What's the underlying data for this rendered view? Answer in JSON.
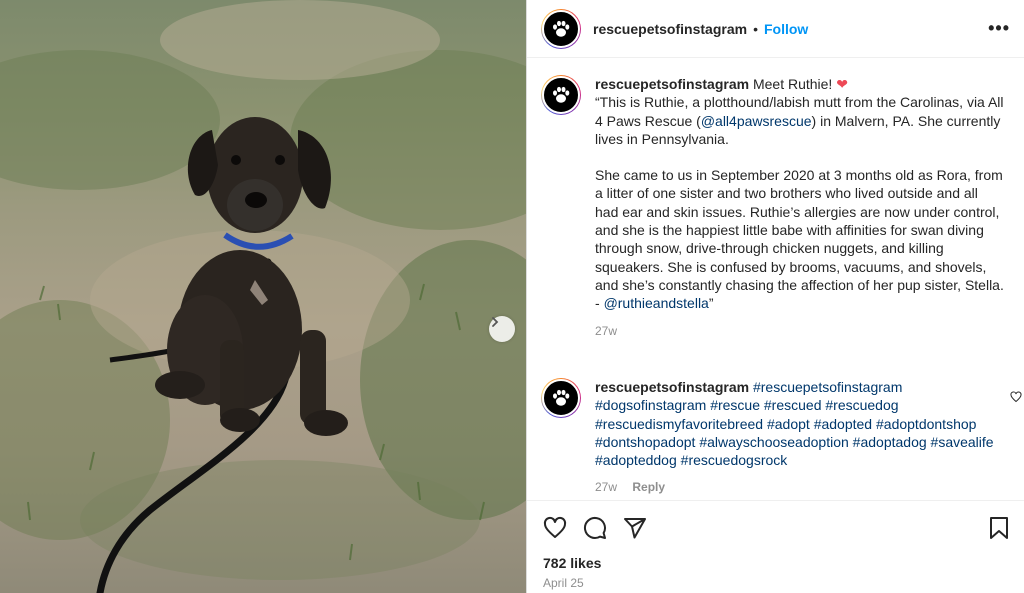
{
  "post": {
    "username": "rescuepetsofinstagram",
    "follow_label": "Follow",
    "more_label": "•••",
    "separator": "•"
  },
  "caption": {
    "username": "rescuepetsofinstagram",
    "title": "Meet Ruthie!",
    "p1_a": "“This is Ruthie, a plotthound/labish mutt from the Carolinas, via All 4 Paws Rescue (",
    "p1_link": "@all4pawsrescue",
    "p1_b": ") in Malvern, PA. She currently lives in Pennsylvania.",
    "p2": "She came to us in September 2020 at 3 months old as Rora, from a litter of one sister and two brothers who lived outside and all had ear and skin issues. Ruthie’s allergies are now under control, and she is the happiest little babe with affinities for swan diving through snow, drive-through chicken nuggets, and killing squeakers. She is confused by brooms, vacuums, and shovels, and she’s constantly chasing the affection of her pup sister, Stella.",
    "p3_prefix": "- ",
    "p3_link": "@ruthieandstella",
    "p3_suffix": "”",
    "age": "27w"
  },
  "comment": {
    "username": "rescuepetsofinstagram",
    "hashtags": [
      "#rescuepetsofinstagram",
      "#dogsofinstagram",
      "#rescue",
      "#rescued",
      "#rescuedog",
      "#rescuedismyfavoritebreed",
      "#adopt",
      "#adopted",
      "#adoptdontshop",
      "#dontshopadopt",
      "#alwayschooseadoption",
      "#adoptadog",
      "#savealife",
      "#adopteddog",
      "#rescuedogsrock"
    ],
    "age": "27w",
    "reply_label": "Reply"
  },
  "footer": {
    "likes": "782 likes",
    "date": "April 25"
  },
  "icons": [
    "paw-icon",
    "heart-icon",
    "comment-icon",
    "share-icon",
    "bookmark-icon",
    "chevron-right-icon",
    "more-icon"
  ],
  "colors": {
    "follow": "#0095f6",
    "link": "#00376b",
    "heart": "#ed4956",
    "muted": "#8e8e8e"
  }
}
